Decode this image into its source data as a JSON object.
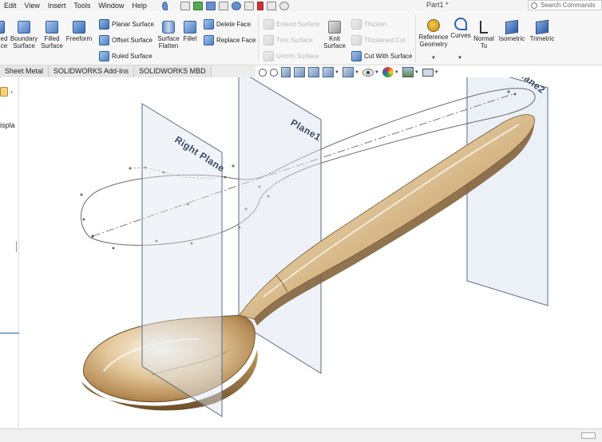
{
  "menu": {
    "items": [
      "Edit",
      "View",
      "Insert",
      "Tools",
      "Window",
      "Help"
    ],
    "document_title": "Part1 *",
    "search_placeholder": "Search Commands"
  },
  "ribbon": {
    "ruled_icon_label": "ed",
    "ruled_icon_label2": "ce",
    "boundary_surface": [
      "Boundary",
      "Surface"
    ],
    "filled_surface": [
      "Filled",
      "Surface"
    ],
    "freeform": "Freeform",
    "planar_surface": "Planar Surface",
    "offset_surface": "Offset Surface",
    "ruled_surface": "Ruled Surface",
    "surface_flatten": [
      "Surface",
      "Flatten"
    ],
    "fillet": "Fillet",
    "delete_face": "Delete Face",
    "replace_face": "Replace Face",
    "extend_surface": "Extend Surface",
    "trim_surface": "Trim Surface",
    "untrim_surface": "Untrim Surface",
    "knit_surface": [
      "Knit",
      "Surface"
    ],
    "thicken": "Thicken",
    "thickened_cut": "Thickened Cut",
    "cut_with_surface": "Cut With Surface",
    "reference_geometry": [
      "Reference",
      "Geometry"
    ],
    "curves": "Curves",
    "normal_to": [
      "Normal",
      "To"
    ],
    "isometric": "Isometric",
    "trimetric": "Trimetric"
  },
  "tabs": [
    "Sheet Metal",
    "SOLIDWORKS Add-Ins",
    "SOLIDWORKS MBD"
  ],
  "left_panel": {
    "truncated_text": "ispla"
  },
  "viewport": {
    "planes": [
      "Right Plane",
      "Plane1",
      "Plane2"
    ]
  },
  "colors": {
    "plane_fill": "#d9e4f1",
    "plane_stroke": "#5a6a85",
    "spoon_light": "#f5ecd8",
    "spoon_mid": "#d8b98a",
    "spoon_dark": "#8a6a3e",
    "sketch": "#6b6b6b"
  }
}
